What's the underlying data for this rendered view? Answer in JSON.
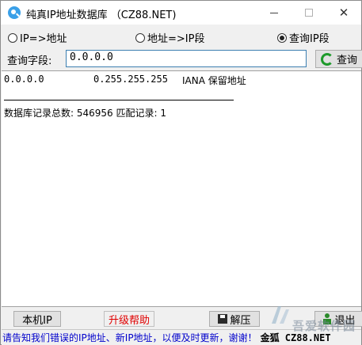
{
  "window": {
    "title": "纯真IP地址数据库  （CZ88.NET)"
  },
  "radios": [
    {
      "label": "IP=>地址",
      "checked": false
    },
    {
      "label": "地址=>IP段",
      "checked": false
    },
    {
      "label": "查询IP段",
      "checked": true
    }
  ],
  "query": {
    "label": "查询字段:",
    "value": "0.0.0.0",
    "button_label": "查询"
  },
  "results": {
    "row": {
      "ip": "0.0.0.0",
      "mask": "0.255.255.255",
      "desc": "IANA 保留地址"
    },
    "summary": "数据库记录总数:  546956  匹配记录:  1"
  },
  "buttons": {
    "local_ip": "本机IP",
    "upgrade_help": "升级帮助",
    "extract": "解压",
    "exit": "退出"
  },
  "statusbar": {
    "message": "请告知我们错误的IP地址、新IP地址，以便及时更新，谢谢！",
    "credit": "金狐 CZ88.NET"
  },
  "watermark": {
    "text": "吾爱软件园"
  },
  "colors": {
    "accent": "#3c7fb1",
    "status_text": "#0000cc",
    "upgrade_text": "#e00000",
    "refresh_icon": "#1d9a2a"
  }
}
